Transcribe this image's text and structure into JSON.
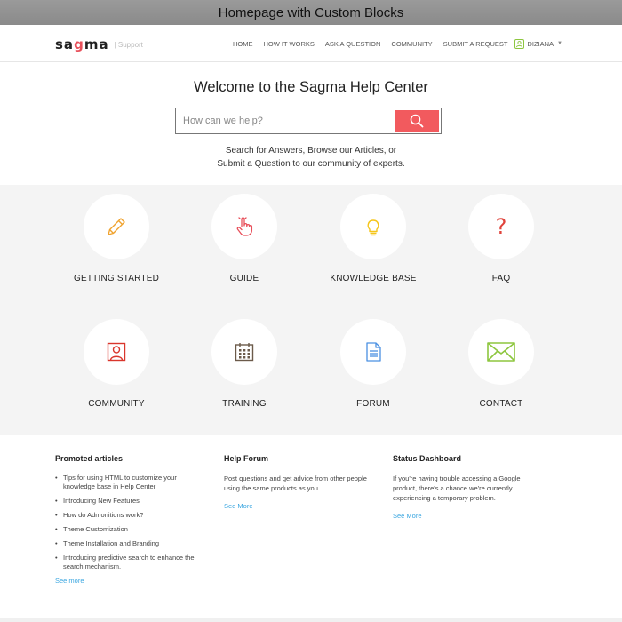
{
  "window": {
    "title": "Homepage with Custom Blocks"
  },
  "brand": {
    "logo_text_1": "sa",
    "logo_text_2": "g",
    "logo_text_3": "ma",
    "logo_sub": "| Support"
  },
  "nav": {
    "items": [
      "HOME",
      "HOW IT WORKS",
      "ASK A QUESTION",
      "COMMUNITY",
      "SUBMIT A REQUEST"
    ],
    "user_name": "DIZIANA"
  },
  "hero": {
    "title": "Welcome to the Sagma Help Center",
    "search_placeholder": "How can we help?",
    "desc_line_1": "Search for Answers, Browse our Articles, or",
    "desc_line_2": "Submit a Question to our community of experts."
  },
  "blocks": [
    {
      "label": "GETTING STARTED",
      "icon": "pencil-icon",
      "color": "#f0a32f"
    },
    {
      "label": "GUIDE",
      "icon": "pointer-hand-icon",
      "color": "#e8505b"
    },
    {
      "label": "KNOWLEDGE BASE",
      "icon": "lightbulb-icon",
      "color": "#f5c518"
    },
    {
      "label": "FAQ",
      "icon": "question-mark-icon",
      "color": "#e0433b"
    },
    {
      "label": "COMMUNITY",
      "icon": "user-portrait-icon",
      "color": "#d9362c"
    },
    {
      "label": "TRAINING",
      "icon": "calendar-icon",
      "color": "#6b5a4a"
    },
    {
      "label": "FORUM",
      "icon": "document-icon",
      "color": "#4a90e2"
    },
    {
      "label": "CONTACT",
      "icon": "envelope-icon",
      "color": "#8dc63f"
    }
  ],
  "promoted": {
    "title": "Promoted articles",
    "items": [
      "Tips for using HTML to customize your knowledge base in Help Center",
      "Introducing New Features",
      "How do Admonitions work?",
      "Theme Customization",
      "Theme Installation and Branding",
      "Introducing predictive search to enhance the search mechanism."
    ],
    "see_more": "See more"
  },
  "forum": {
    "title": "Help Forum",
    "text": "Post questions and get advice from other people using the same products as you.",
    "see_more": "See More"
  },
  "status": {
    "title": "Status Dashboard",
    "text": "If you're having trouble accessing a Google product, there's a chance we're currently experiencing a temporary problem.",
    "see_more": "See More"
  }
}
